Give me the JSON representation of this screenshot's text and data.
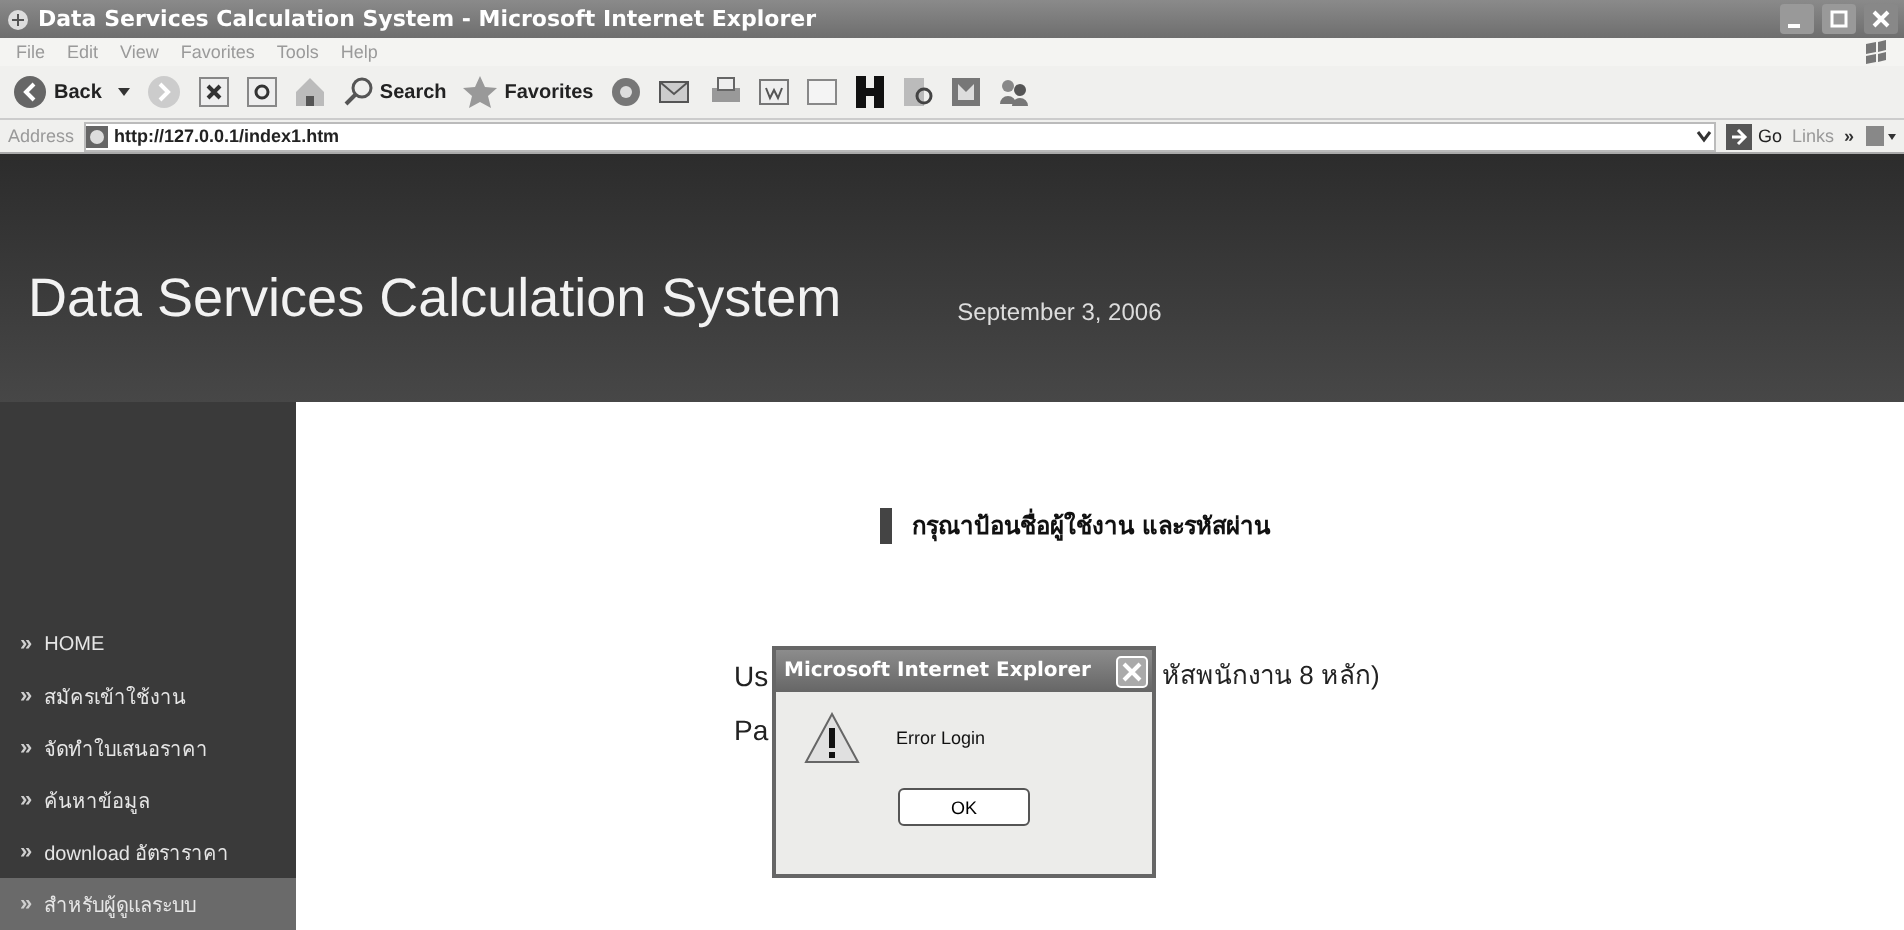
{
  "window": {
    "title": "Data Services Calculation System - Microsoft Internet Explorer"
  },
  "menu": [
    "File",
    "Edit",
    "View",
    "Favorites",
    "Tools",
    "Help"
  ],
  "toolbar": {
    "back": "Back",
    "search": "Search",
    "favorites": "Favorites"
  },
  "address": {
    "label": "Address",
    "url": "http://127.0.0.1/index1.htm",
    "go": "Go",
    "links": "Links",
    "more": "»"
  },
  "site": {
    "title": "Data Services Calculation System",
    "date": "September 3, 2006"
  },
  "sidebar": {
    "items": [
      {
        "bullet": "»",
        "label": "HOME",
        "selected": false
      },
      {
        "bullet": "»",
        "label": "สมัครเข้าใช้งาน",
        "selected": false
      },
      {
        "bullet": "»",
        "label": "จัดทำใบเสนอราคา",
        "selected": false
      },
      {
        "bullet": "»",
        "label": "ค้นหาข้อมูล",
        "selected": false
      },
      {
        "bullet": "»",
        "label": "download อัตราราคา",
        "selected": false
      },
      {
        "bullet": "»",
        "label": "สำหรับผู้ดูแลระบบ",
        "selected": true
      }
    ]
  },
  "login": {
    "heading": "กรุณาป้อนชื่อผู้ใช้งาน และรหัสผ่าน",
    "user_label": "Us",
    "user_hint": "หัสพนักงาน 8 หลัก)",
    "password_label": "Pa"
  },
  "dialog": {
    "title": "Microsoft Internet Explorer",
    "message": "Error Login",
    "button": "OK"
  }
}
